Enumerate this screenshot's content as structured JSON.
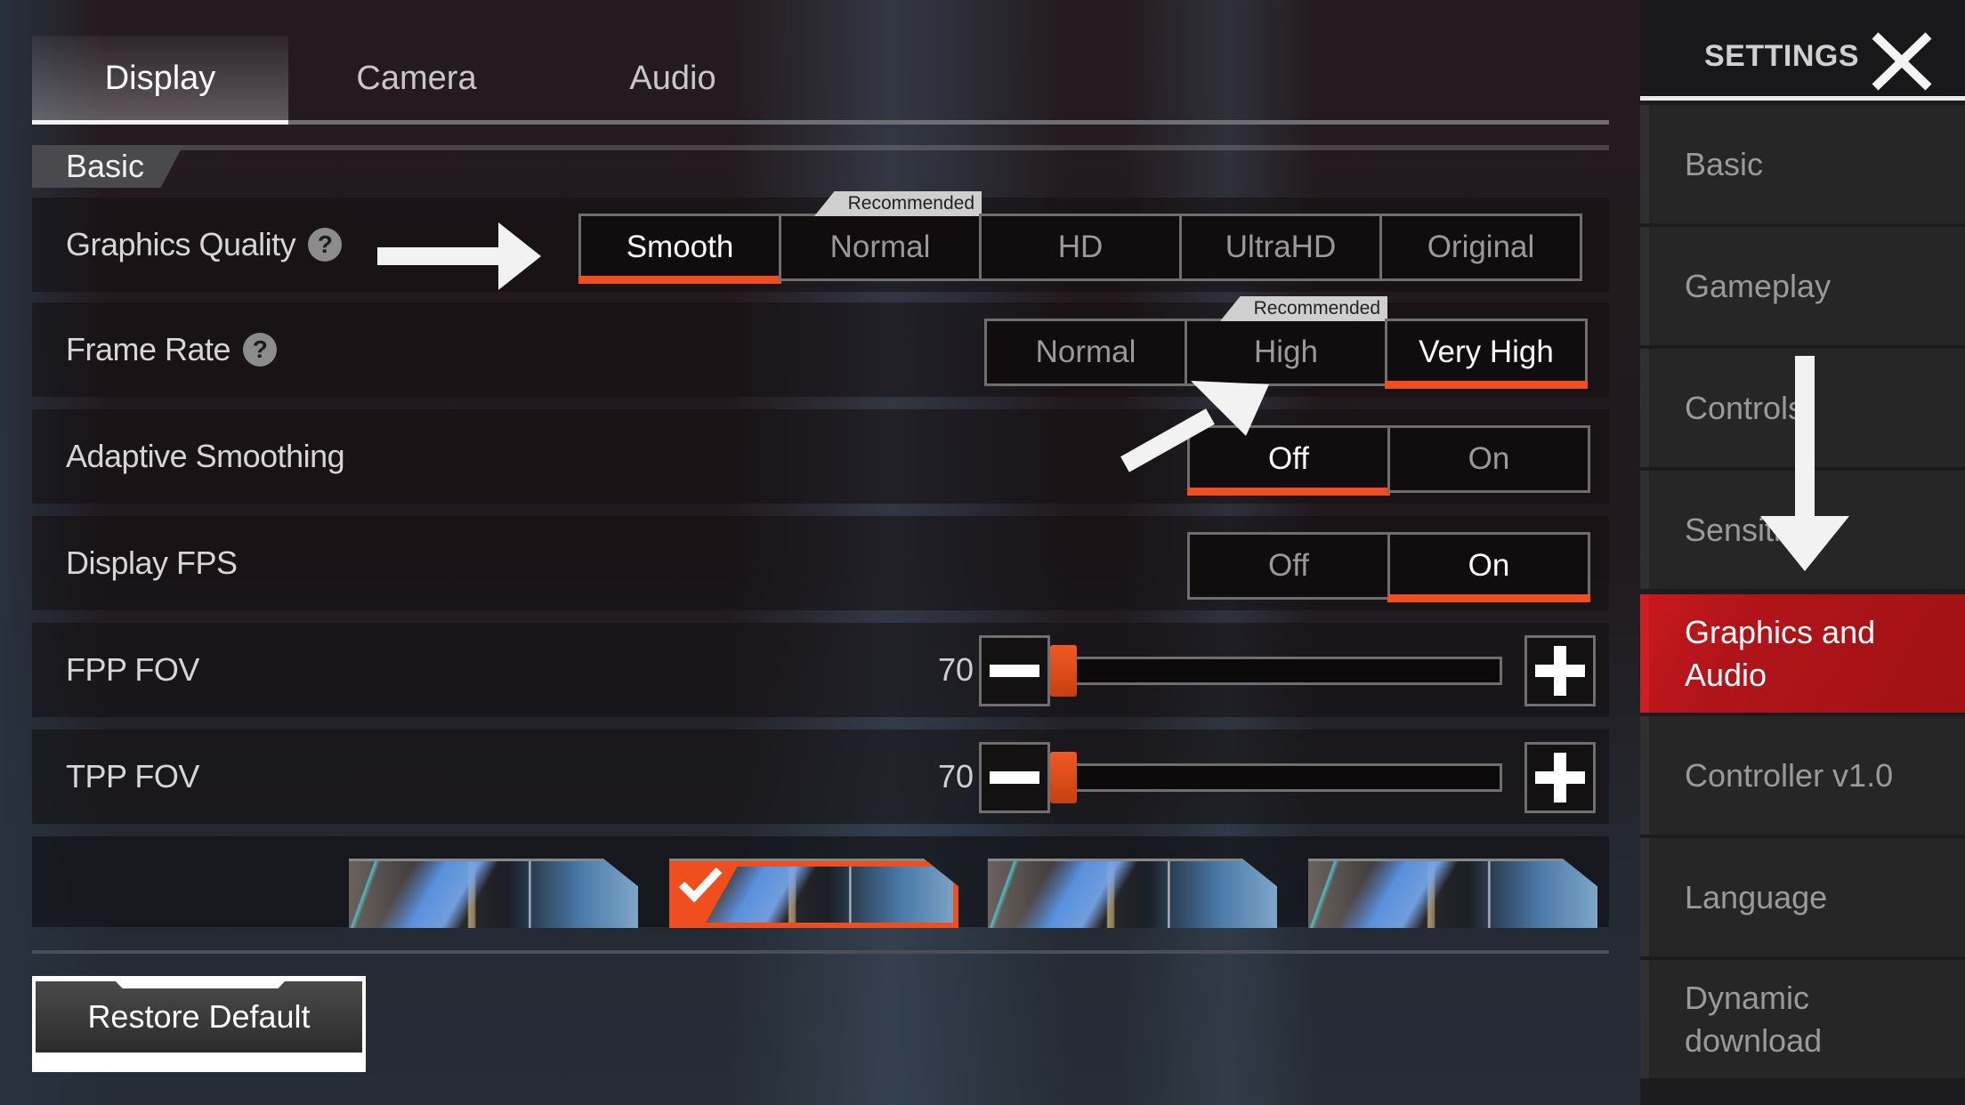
{
  "tabs": [
    {
      "label": "Display",
      "active": true
    },
    {
      "label": "Camera",
      "active": false
    },
    {
      "label": "Audio",
      "active": false
    }
  ],
  "section": {
    "label": "Basic"
  },
  "settings": {
    "graphics_quality": {
      "label": "Graphics Quality",
      "help_icon": "question-circle",
      "options": [
        "Smooth",
        "Normal",
        "HD",
        "UltraHD",
        "Original"
      ],
      "selected": "Smooth",
      "recommended": "Normal",
      "recommended_label": "Recommended"
    },
    "frame_rate": {
      "label": "Frame Rate",
      "help_icon": "question-circle",
      "options": [
        "Normal",
        "High",
        "Very High"
      ],
      "selected": "Very High",
      "recommended": "High",
      "recommended_label": "Recommended"
    },
    "adaptive_smoothing": {
      "label": "Adaptive Smoothing",
      "options": [
        "Off",
        "On"
      ],
      "selected": "Off"
    },
    "display_fps": {
      "label": "Display FPS",
      "options": [
        "Off",
        "On"
      ],
      "selected": "On"
    },
    "fpp_fov": {
      "label": "FPP FOV",
      "value": "70",
      "slider_fraction": 0.0
    },
    "tpp_fov": {
      "label": "TPP FOV",
      "value": "70",
      "slider_fraction": 0.0
    }
  },
  "style_presets": {
    "count": 4,
    "selected_index": 1
  },
  "restore_default_label": "Restore Default",
  "sidebar": {
    "title": "SETTINGS",
    "close_icon": "close-x",
    "items": [
      {
        "label": "Basic",
        "active": false
      },
      {
        "label": "Gameplay",
        "active": false
      },
      {
        "label": "Controls",
        "active": false
      },
      {
        "label": "Sensitivity",
        "active": false
      },
      {
        "label": "Graphics and Audio",
        "active": true
      },
      {
        "label": "Controller v1.0",
        "active": false
      },
      {
        "label": "Language",
        "active": false
      },
      {
        "label": "Dynamic download",
        "active": false
      }
    ]
  },
  "colors": {
    "accent_orange": "#f04e1c",
    "active_red": "#c8191d",
    "annotation_arrow": "#f2f2f2"
  }
}
